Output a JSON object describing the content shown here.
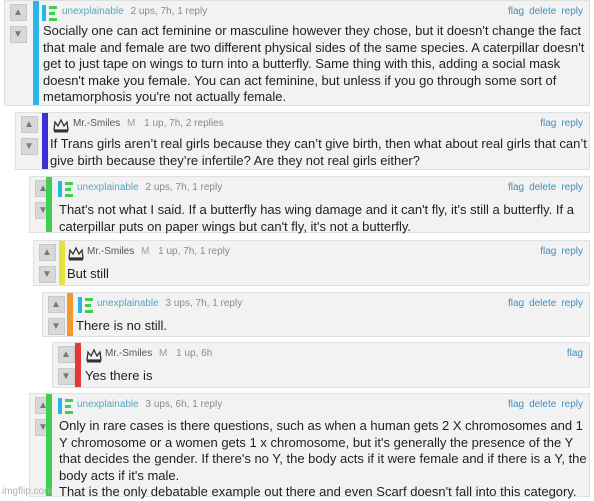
{
  "icons": {
    "upvote": "▲",
    "downvote": "▼"
  },
  "colors": {
    "c1": "#29b6e7",
    "c2": "#3b2fd8",
    "c3": "#3fcf4e",
    "c4": "#e2e23a",
    "c5": "#f29a2e",
    "c6": "#e53935",
    "c7": "#3fcf4e"
  },
  "comments": [
    {
      "user": "unexplainable",
      "stats": "2 ups, 7h, 1 reply",
      "actions": [
        "flag",
        "delete",
        "reply"
      ],
      "text": "Socially one can act feminine or masculine however they chose, but it doesn't change the fact that male and female are two different physical sides of the same species. A caterpillar doesn't get to just tape on wings to turn into a butterfly. Same thing with this, adding a social mask doesn't make you female. You can act feminine, but unless if you go through some sort of metamorphosis you're not actually female."
    },
    {
      "user": "Mr.-Smiles",
      "rank": "M",
      "stats": "1 up, 7h, 2 replies",
      "actions": [
        "flag",
        "reply"
      ],
      "text": "If Trans girls aren’t real girls because they can’t give birth, then what about real girls that can’t give birth because they’re infertile? Are they not real girls either?"
    },
    {
      "user": "unexplainable",
      "stats": "2 ups, 7h, 1 reply",
      "actions": [
        "flag",
        "delete",
        "reply"
      ],
      "text": "That's not what I said. If a butterfly has wing damage and it can't fly, it's still a butterfly. If a caterpillar puts on paper wings but can't fly, it's not a butterfly."
    },
    {
      "user": "Mr.-Smiles",
      "rank": "M",
      "stats": "1 up, 7h, 1 reply",
      "actions": [
        "flag",
        "reply"
      ],
      "text": "But still"
    },
    {
      "user": "unexplainable",
      "stats": "3 ups, 7h, 1 reply",
      "actions": [
        "flag",
        "delete",
        "reply"
      ],
      "text": "There is no still."
    },
    {
      "user": "Mr.-Smiles",
      "rank": "M",
      "stats": "1 up, 6h",
      "actions": [
        "flag"
      ],
      "text": "Yes there is"
    },
    {
      "user": "unexplainable",
      "stats": "3 ups, 6h, 1 reply",
      "actions": [
        "flag",
        "delete",
        "reply"
      ],
      "text": "Only in rare cases is there questions, such as when a human gets 2 X chromosomes and 1 Y chromosome or a women gets 1 x chromosome, but it's generally the presence of the Y that decides the gender. If there's no Y, the body acts if it were female and if there is a Y, the body acts if it's male.\nThat is the only debatable example out there and even Scarf doesn't fall into this category."
    }
  ],
  "watermark": "imgflip.com"
}
